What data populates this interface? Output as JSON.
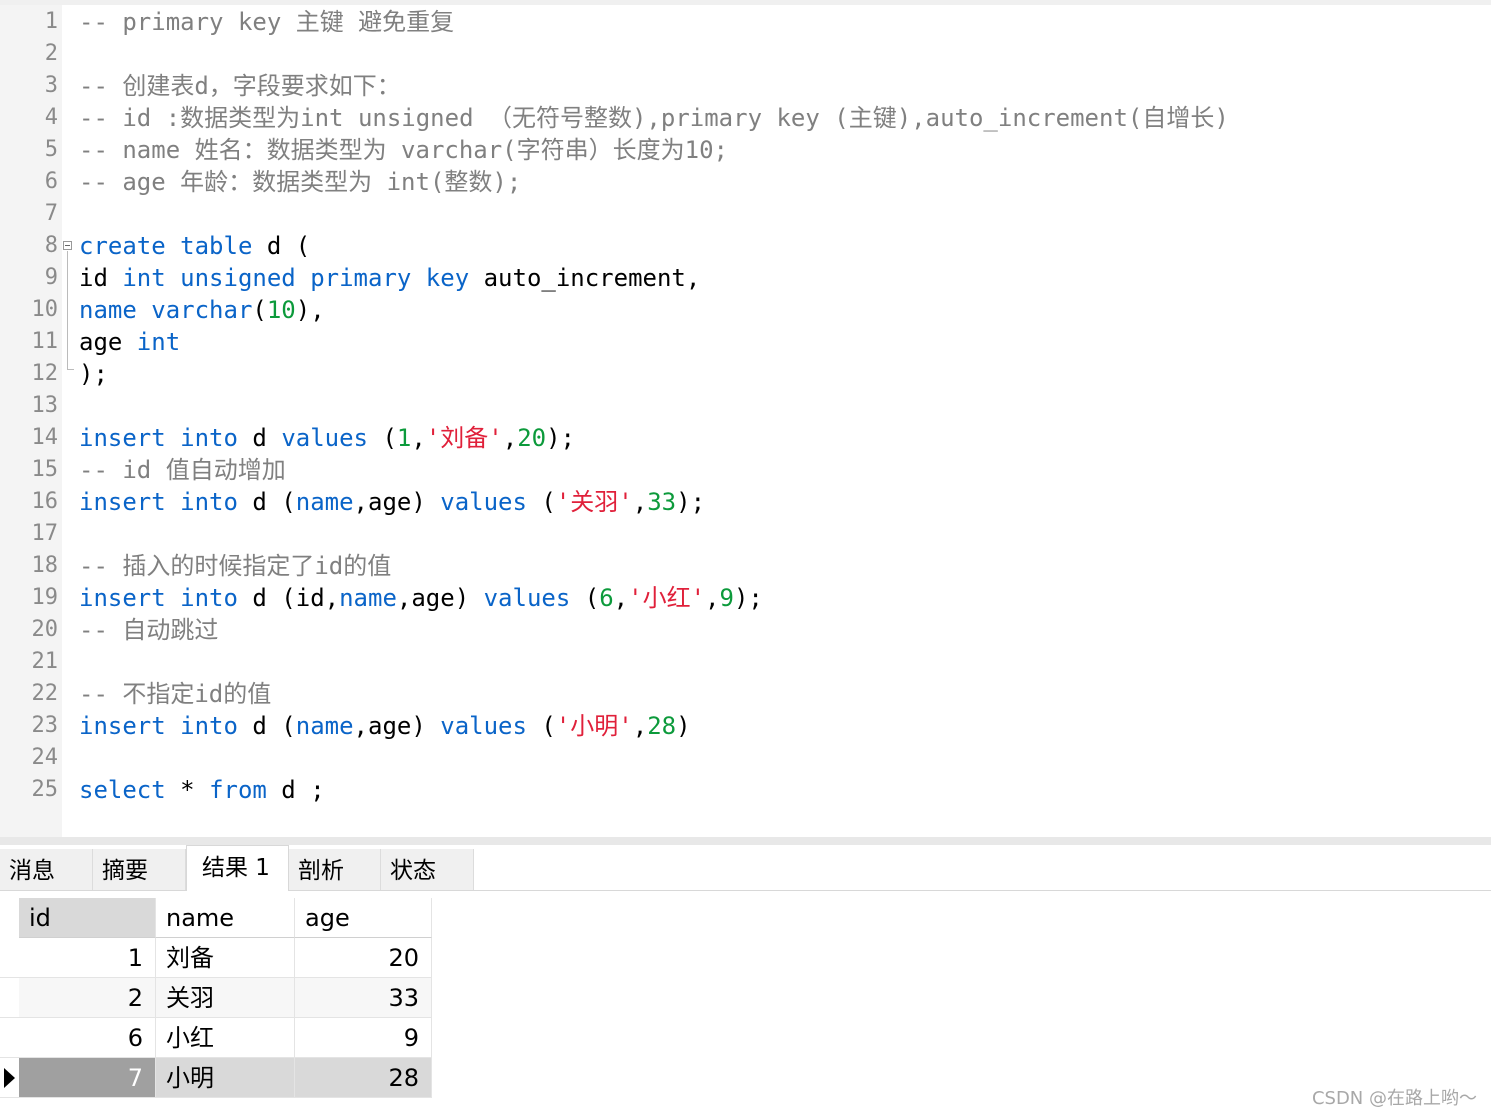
{
  "editor": {
    "lines": [
      {
        "num": "1",
        "tokens": [
          {
            "t": "-- primary key 主键 避免重复",
            "c": "cm"
          }
        ]
      },
      {
        "num": "2",
        "tokens": []
      },
      {
        "num": "3",
        "tokens": [
          {
            "t": "-- 创建表d，字段要求如下：",
            "c": "cm"
          }
        ]
      },
      {
        "num": "4",
        "tokens": [
          {
            "t": "-- id :数据类型为int unsigned （无符号整数),primary key (主键),auto_increment(自增长)",
            "c": "cm"
          }
        ]
      },
      {
        "num": "5",
        "tokens": [
          {
            "t": "-- name 姓名：数据类型为 varchar(字符串）长度为10;",
            "c": "cm"
          }
        ]
      },
      {
        "num": "6",
        "tokens": [
          {
            "t": "-- age 年龄：数据类型为 int(整数);",
            "c": "cm"
          }
        ]
      },
      {
        "num": "7",
        "tokens": []
      },
      {
        "num": "8",
        "fold": "start",
        "tokens": [
          {
            "t": "create table",
            "c": "kw"
          },
          {
            "t": " d (",
            "c": ""
          }
        ]
      },
      {
        "num": "9",
        "tokens": [
          {
            "t": "id ",
            "c": ""
          },
          {
            "t": "int unsigned primary key",
            "c": "kw"
          },
          {
            "t": " auto_increment,",
            "c": ""
          }
        ]
      },
      {
        "num": "10",
        "tokens": [
          {
            "t": "name varchar",
            "c": "kw"
          },
          {
            "t": "(",
            "c": ""
          },
          {
            "t": "10",
            "c": "num"
          },
          {
            "t": "),",
            "c": ""
          }
        ]
      },
      {
        "num": "11",
        "tokens": [
          {
            "t": "age ",
            "c": ""
          },
          {
            "t": "int",
            "c": "kw"
          }
        ]
      },
      {
        "num": "12",
        "fold": "end",
        "tokens": [
          {
            "t": ");",
            "c": ""
          }
        ]
      },
      {
        "num": "13",
        "tokens": []
      },
      {
        "num": "14",
        "tokens": [
          {
            "t": "insert into",
            "c": "kw"
          },
          {
            "t": " d ",
            "c": ""
          },
          {
            "t": "values",
            "c": "kw"
          },
          {
            "t": " (",
            "c": ""
          },
          {
            "t": "1",
            "c": "num"
          },
          {
            "t": ",",
            "c": ""
          },
          {
            "t": "'刘备'",
            "c": "str"
          },
          {
            "t": ",",
            "c": ""
          },
          {
            "t": "20",
            "c": "num"
          },
          {
            "t": ");",
            "c": ""
          }
        ]
      },
      {
        "num": "15",
        "tokens": [
          {
            "t": "-- id 值自动增加",
            "c": "cm"
          }
        ]
      },
      {
        "num": "16",
        "tokens": [
          {
            "t": "insert into",
            "c": "kw"
          },
          {
            "t": " d (",
            "c": ""
          },
          {
            "t": "name",
            "c": "kw"
          },
          {
            "t": ",age) ",
            "c": ""
          },
          {
            "t": "values",
            "c": "kw"
          },
          {
            "t": " (",
            "c": ""
          },
          {
            "t": "'关羽'",
            "c": "str"
          },
          {
            "t": ",",
            "c": ""
          },
          {
            "t": "33",
            "c": "num"
          },
          {
            "t": ");",
            "c": ""
          }
        ]
      },
      {
        "num": "17",
        "tokens": []
      },
      {
        "num": "18",
        "tokens": [
          {
            "t": "-- 插入的时候指定了id的值",
            "c": "cm"
          }
        ]
      },
      {
        "num": "19",
        "tokens": [
          {
            "t": "insert into",
            "c": "kw"
          },
          {
            "t": " d (id,",
            "c": ""
          },
          {
            "t": "name",
            "c": "kw"
          },
          {
            "t": ",age) ",
            "c": ""
          },
          {
            "t": "values",
            "c": "kw"
          },
          {
            "t": " (",
            "c": ""
          },
          {
            "t": "6",
            "c": "num"
          },
          {
            "t": ",",
            "c": ""
          },
          {
            "t": "'小红'",
            "c": "str"
          },
          {
            "t": ",",
            "c": ""
          },
          {
            "t": "9",
            "c": "num"
          },
          {
            "t": ");",
            "c": ""
          }
        ]
      },
      {
        "num": "20",
        "tokens": [
          {
            "t": "-- 自动跳过",
            "c": "cm"
          }
        ]
      },
      {
        "num": "21",
        "tokens": []
      },
      {
        "num": "22",
        "tokens": [
          {
            "t": "-- 不指定id的值",
            "c": "cm"
          }
        ]
      },
      {
        "num": "23",
        "tokens": [
          {
            "t": "insert into",
            "c": "kw"
          },
          {
            "t": " d (",
            "c": ""
          },
          {
            "t": "name",
            "c": "kw"
          },
          {
            "t": ",age) ",
            "c": ""
          },
          {
            "t": "values",
            "c": "kw"
          },
          {
            "t": " (",
            "c": ""
          },
          {
            "t": "'小明'",
            "c": "str"
          },
          {
            "t": ",",
            "c": ""
          },
          {
            "t": "28",
            "c": "num"
          },
          {
            "t": ")",
            "c": ""
          }
        ]
      },
      {
        "num": "24",
        "tokens": []
      },
      {
        "num": "25",
        "tokens": [
          {
            "t": "select",
            "c": "kw"
          },
          {
            "t": " * ",
            "c": ""
          },
          {
            "t": "from",
            "c": "kw"
          },
          {
            "t": " d ;",
            "c": ""
          }
        ]
      }
    ]
  },
  "result_tabs": [
    {
      "label": "消息",
      "active": false
    },
    {
      "label": "摘要",
      "active": false
    },
    {
      "label": "结果 1",
      "active": true
    },
    {
      "label": "剖析",
      "active": false
    },
    {
      "label": "状态",
      "active": false
    }
  ],
  "result_grid": {
    "columns": [
      "id",
      "name",
      "age"
    ],
    "rows": [
      {
        "id": "1",
        "name": "刘备",
        "age": "20",
        "selected": false
      },
      {
        "id": "2",
        "name": "关羽",
        "age": "33",
        "selected": false
      },
      {
        "id": "6",
        "name": "小红",
        "age": "9",
        "selected": false
      },
      {
        "id": "7",
        "name": "小明",
        "age": "28",
        "selected": true
      }
    ]
  },
  "watermark": "CSDN @在路上哟～",
  "colors": {
    "keyword": "#0a64c8",
    "number": "#0c9a3b",
    "string": "#e0203a",
    "comment": "#808080"
  }
}
